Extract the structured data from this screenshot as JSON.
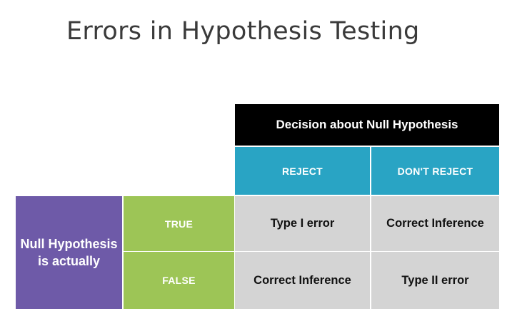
{
  "title": "Errors in Hypothesis Testing",
  "table": {
    "decision_header": "Decision about Null Hypothesis",
    "columns": [
      "REJECT",
      "DON'T REJECT"
    ],
    "row_header": "Null Hypothesis is actually",
    "rows": [
      {
        "label": "TRUE",
        "cells": [
          "Type I error",
          "Correct Inference"
        ]
      },
      {
        "label": "FALSE",
        "cells": [
          "Correct Inference",
          "Type II error"
        ]
      }
    ]
  },
  "colors": {
    "decision_header_bg": "#000000",
    "column_header_bg": "#29a4c4",
    "row_header_bg": "#6e5aa8",
    "row_label_bg": "#9dc556",
    "result_cell_bg": "#d4d4d4"
  }
}
